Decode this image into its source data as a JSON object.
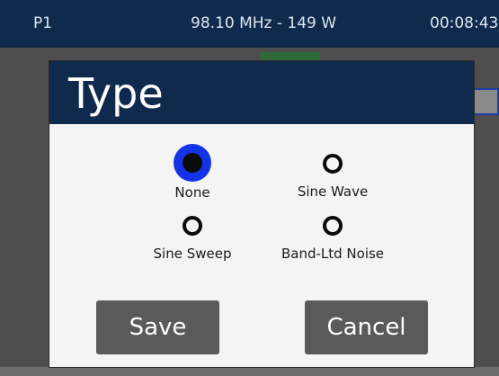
{
  "status_bar": {
    "preset": "P1",
    "frequency_power": "98.10 MHz - 149 W",
    "time": "00:08:43"
  },
  "dialog": {
    "title": "Type",
    "options": [
      {
        "label": "None",
        "selected": true
      },
      {
        "label": "Sine Wave",
        "selected": false
      },
      {
        "label": "Sine Sweep",
        "selected": false
      },
      {
        "label": "Band-Ltd Noise",
        "selected": false
      }
    ],
    "save_label": "Save",
    "cancel_label": "Cancel"
  },
  "colors": {
    "header_navy": "#0f2a4d",
    "selected_radio_blue": "#1433e6",
    "button_gray": "#5a5a5a",
    "dialog_bg": "#f4f4f4"
  },
  "icons": {
    "radio_selected": "radio-selected-icon",
    "radio_unselected": "radio-unselected-icon"
  }
}
